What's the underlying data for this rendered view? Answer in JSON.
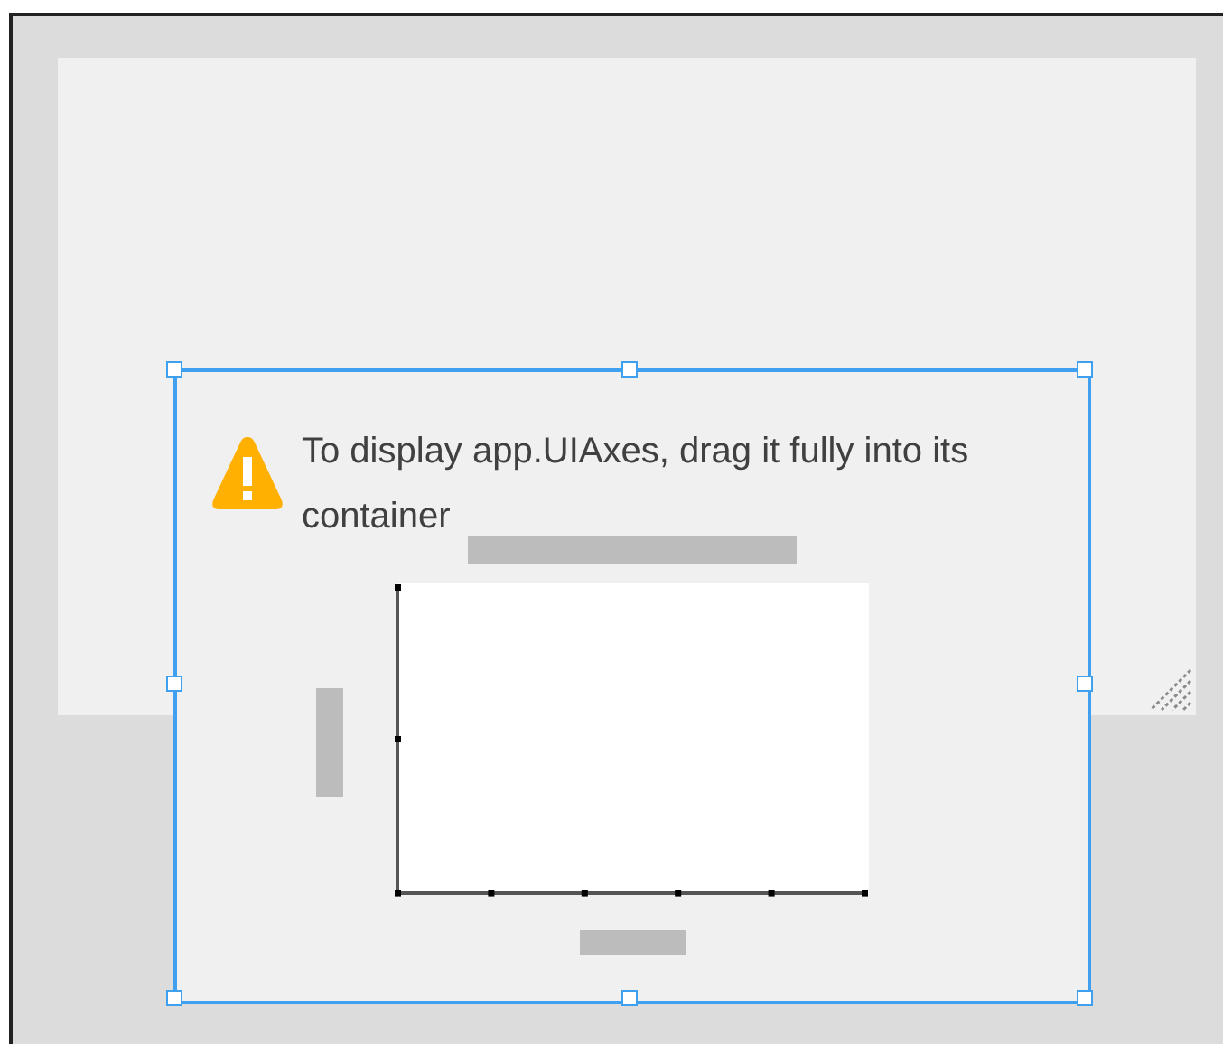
{
  "component": {
    "selected": true,
    "message": "To display app.UIAxes, drag it fully into its container"
  }
}
